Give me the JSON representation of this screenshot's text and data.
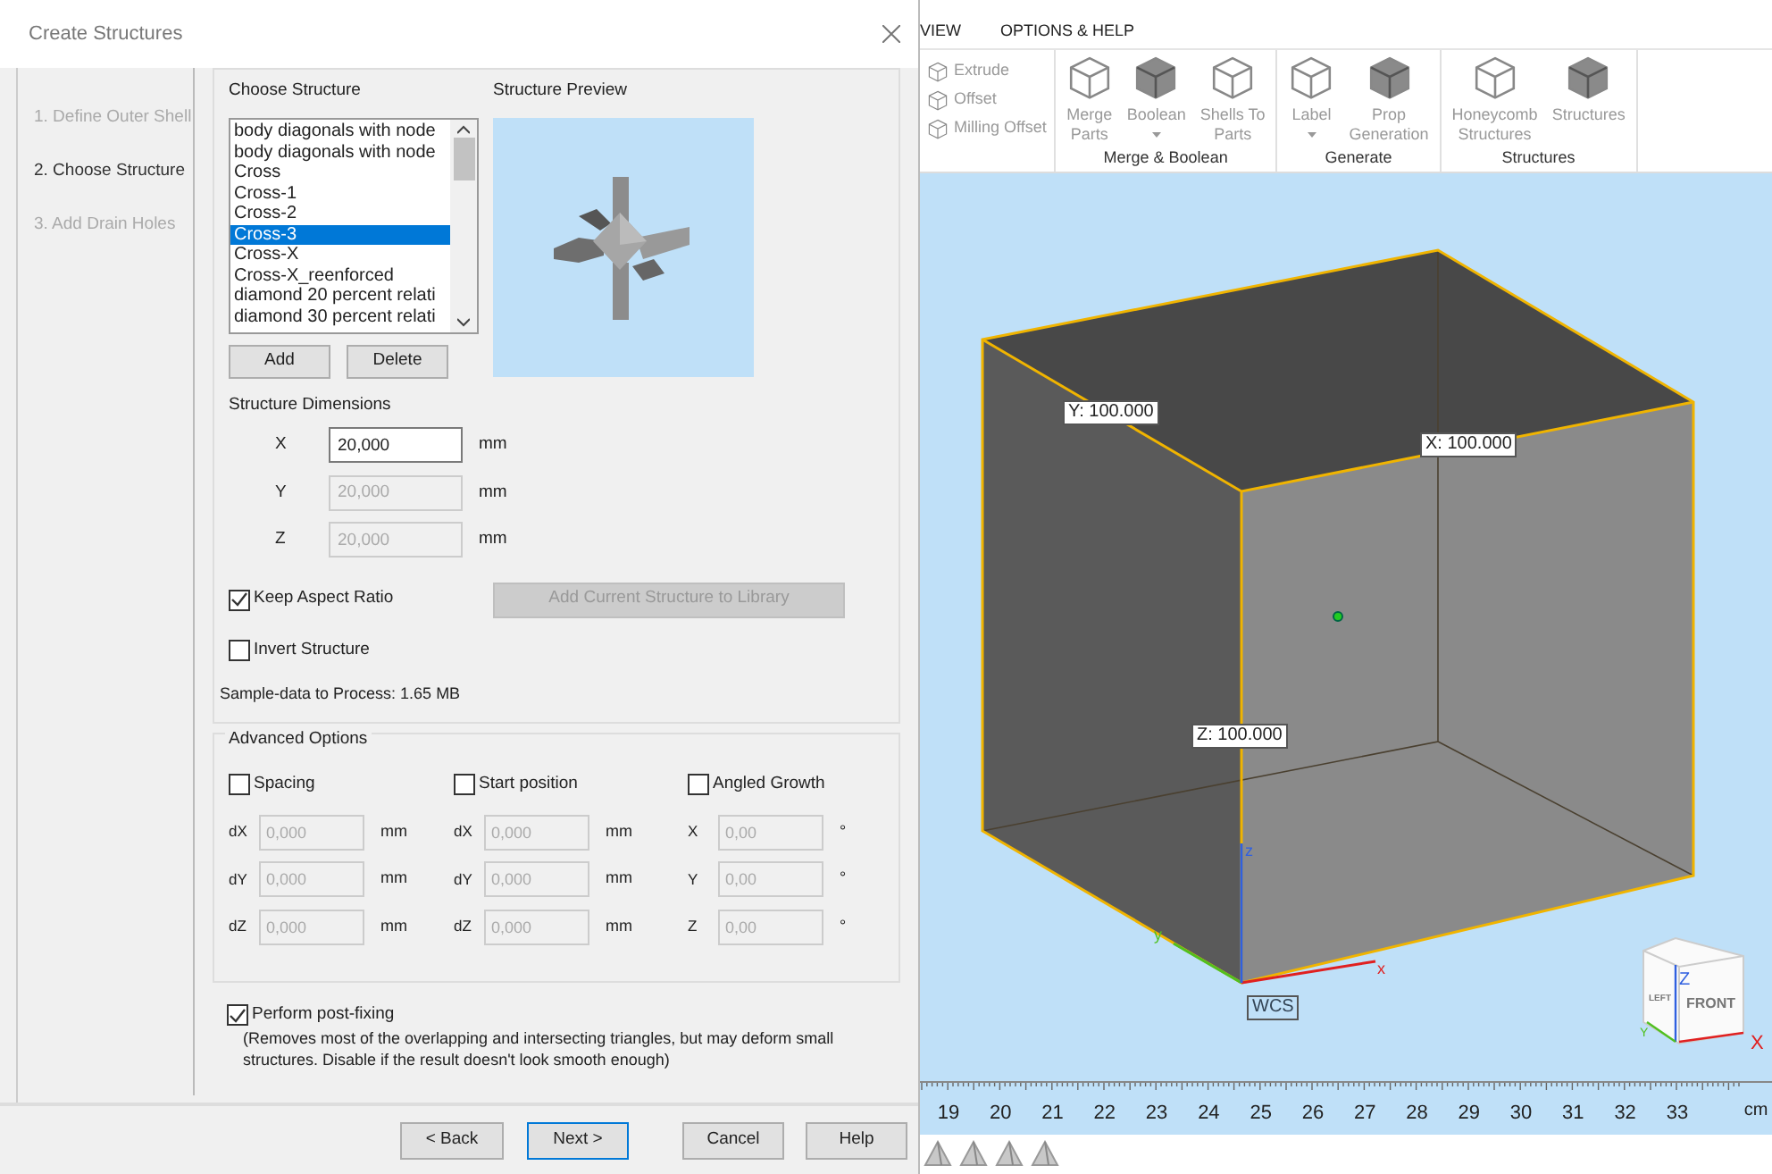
{
  "dialog": {
    "title": "Create Structures"
  },
  "steps": [
    {
      "label": "1. Define Outer Shell",
      "selected": false
    },
    {
      "label": "2. Choose Structure",
      "selected": true
    },
    {
      "label": "3. Add Drain Holes",
      "selected": false
    }
  ],
  "structure_list": {
    "heading": "Choose Structure",
    "items": [
      {
        "label": "body diagonals with node",
        "selected": false
      },
      {
        "label": "body diagonals with node",
        "selected": false
      },
      {
        "label": "Cross",
        "selected": false
      },
      {
        "label": "Cross-1",
        "selected": false
      },
      {
        "label": "Cross-2",
        "selected": false
      },
      {
        "label": "Cross-3",
        "selected": true
      },
      {
        "label": "Cross-X",
        "selected": false
      },
      {
        "label": "Cross-X_reenforced",
        "selected": false
      },
      {
        "label": "diamond 20 percent relati",
        "selected": false
      },
      {
        "label": "diamond 30 percent relati",
        "selected": false
      }
    ]
  },
  "list_buttons": [
    "Add",
    "Delete"
  ],
  "preview": {
    "heading": "Structure Preview"
  },
  "dimensions": {
    "heading": "Structure Dimensions",
    "rows": [
      {
        "axis": "X",
        "value": "20,000",
        "unit": "mm",
        "disabled": false
      },
      {
        "axis": "Y",
        "value": "20,000",
        "unit": "mm",
        "disabled": true
      },
      {
        "axis": "Z",
        "value": "20,000",
        "unit": "mm",
        "disabled": true
      }
    ]
  },
  "options": [
    {
      "label": "Keep Aspect Ratio",
      "checked": true
    },
    {
      "label": "Invert Structure",
      "checked": false
    }
  ],
  "library_button": {
    "label": "Add Current Structure to Library",
    "disabled": true
  },
  "sample_data": "Sample-data to Process: 1.65 MB",
  "advanced": {
    "title": "Advanced Options",
    "groups": [
      {
        "label": "Spacing",
        "checked": false,
        "rows": [
          {
            "axis": "dX",
            "value": "0,000",
            "unit": "mm",
            "disabled": true
          },
          {
            "axis": "dY",
            "value": "0,000",
            "unit": "mm",
            "disabled": true
          },
          {
            "axis": "dZ",
            "value": "0,000",
            "unit": "mm",
            "disabled": true
          }
        ]
      },
      {
        "label": "Start position",
        "checked": false,
        "rows": [
          {
            "axis": "dX",
            "value": "0,000",
            "unit": "mm",
            "disabled": true
          },
          {
            "axis": "dY",
            "value": "0,000",
            "unit": "mm",
            "disabled": true
          },
          {
            "axis": "dZ",
            "value": "0,000",
            "unit": "mm",
            "disabled": true
          }
        ]
      },
      {
        "label": "Angled Growth",
        "checked": false,
        "rows": [
          {
            "axis": "X",
            "value": "0,00",
            "unit": "°",
            "disabled": true
          },
          {
            "axis": "Y",
            "value": "0,00",
            "unit": "°",
            "disabled": true
          },
          {
            "axis": "Z",
            "value": "0,00",
            "unit": "°",
            "disabled": true
          }
        ]
      }
    ]
  },
  "post_fixing": {
    "label": "Perform post-fixing",
    "checked": true,
    "note": "(Removes most of the overlapping and intersecting triangles, but may deform small structures. Disable if the result doesn't look smooth enough)"
  },
  "footer_buttons": [
    {
      "label": "< Back",
      "default": false
    },
    {
      "label": "Next >",
      "default": true
    },
    {
      "label": "Cancel",
      "default": false
    },
    {
      "label": "Help",
      "default": false
    }
  ],
  "menu_tabs": [
    "VIEW",
    "OPTIONS & HELP"
  ],
  "ribbon": [
    {
      "items": [
        {
          "kind": "small",
          "label": "Extrude",
          "disabled": true
        },
        {
          "kind": "small",
          "label": "Offset",
          "disabled": true
        },
        {
          "kind": "small",
          "label": "Milling Offset",
          "disabled": true
        }
      ]
    },
    {
      "label": "Merge & Boolean",
      "items": [
        {
          "kind": "large",
          "label": "Merge\nParts",
          "disabled": true,
          "dropdown": false
        },
        {
          "kind": "large",
          "label": "Boolean",
          "disabled": true,
          "dropdown": true
        },
        {
          "kind": "large",
          "label": "Shells To\nParts",
          "disabled": true,
          "dropdown": false
        }
      ]
    },
    {
      "label": "Generate",
      "items": [
        {
          "kind": "large",
          "label": "Label",
          "disabled": true,
          "dropdown": true
        },
        {
          "kind": "large",
          "label": "Prop\nGeneration",
          "disabled": true,
          "dropdown": false
        }
      ]
    },
    {
      "label": "Structures",
      "items": [
        {
          "kind": "large",
          "label": "Honeycomb\nStructures",
          "disabled": true,
          "dropdown": false
        },
        {
          "kind": "large",
          "label": "Structures",
          "disabled": true,
          "dropdown": false
        }
      ]
    }
  ],
  "viewport": {
    "dimension_labels": [
      "Y: 100.000",
      "X: 100.000",
      "Z: 100.000"
    ],
    "axis_letters": [
      "x",
      "y",
      "z"
    ],
    "wcs_label": "WCS",
    "view_cube": {
      "faces": [
        "LEFT",
        "FRONT"
      ],
      "axes": [
        "Z",
        "X",
        "Y"
      ]
    }
  },
  "ruler": {
    "labels": [
      "19",
      "20",
      "21",
      "22",
      "23",
      "24",
      "25",
      "26",
      "27",
      "28",
      "29",
      "30",
      "31",
      "32",
      "33"
    ],
    "unit": "cm"
  }
}
